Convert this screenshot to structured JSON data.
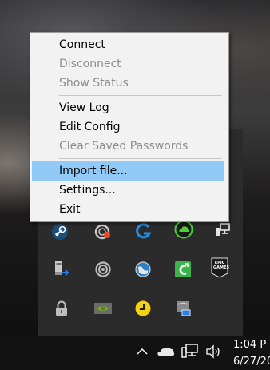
{
  "context_menu": {
    "items": [
      {
        "label": "Connect",
        "enabled": true,
        "highlighted": false
      },
      {
        "label": "Disconnect",
        "enabled": false,
        "highlighted": false
      },
      {
        "label": "Show Status",
        "enabled": false,
        "highlighted": false
      },
      {
        "label": "View Log",
        "enabled": true,
        "highlighted": false
      },
      {
        "label": "Edit Config",
        "enabled": true,
        "highlighted": false
      },
      {
        "label": "Clear Saved Passwords",
        "enabled": false,
        "highlighted": false
      },
      {
        "label": "Import file...",
        "enabled": true,
        "highlighted": true
      },
      {
        "label": "Settings...",
        "enabled": true,
        "highlighted": false
      },
      {
        "label": "Exit",
        "enabled": true,
        "highlighted": false
      }
    ]
  },
  "tray_icons": {
    "row1": [
      "steam-icon",
      "ubisoft-icon",
      "logitech-g-icon",
      "razer-cloud-icon",
      "network-monitor-icon"
    ],
    "row2": [
      "usb-device-icon",
      "ccleaner-icon",
      "display-globe-icon",
      "cc-green-icon",
      "epic-games-icon"
    ],
    "row3": [
      "openvpn-lock-icon",
      "nvidia-icon",
      "yellow-clock-icon",
      "printer-network-icon"
    ],
    "epic_text": "EPIC GAMES"
  },
  "taskbar": {
    "icons": [
      "show-hidden-icons-chevron",
      "onedrive-cloud-icon",
      "network-icon",
      "volume-icon"
    ],
    "clock_time": "1:04 P",
    "clock_date": "6/27/20"
  },
  "colors": {
    "menu_bg": "#f2f2f2",
    "highlight": "#91c9f7",
    "disabled_text": "#8d8d8d",
    "tray_bg": "#2b2b2b",
    "taskbar_bg": "#121212"
  }
}
